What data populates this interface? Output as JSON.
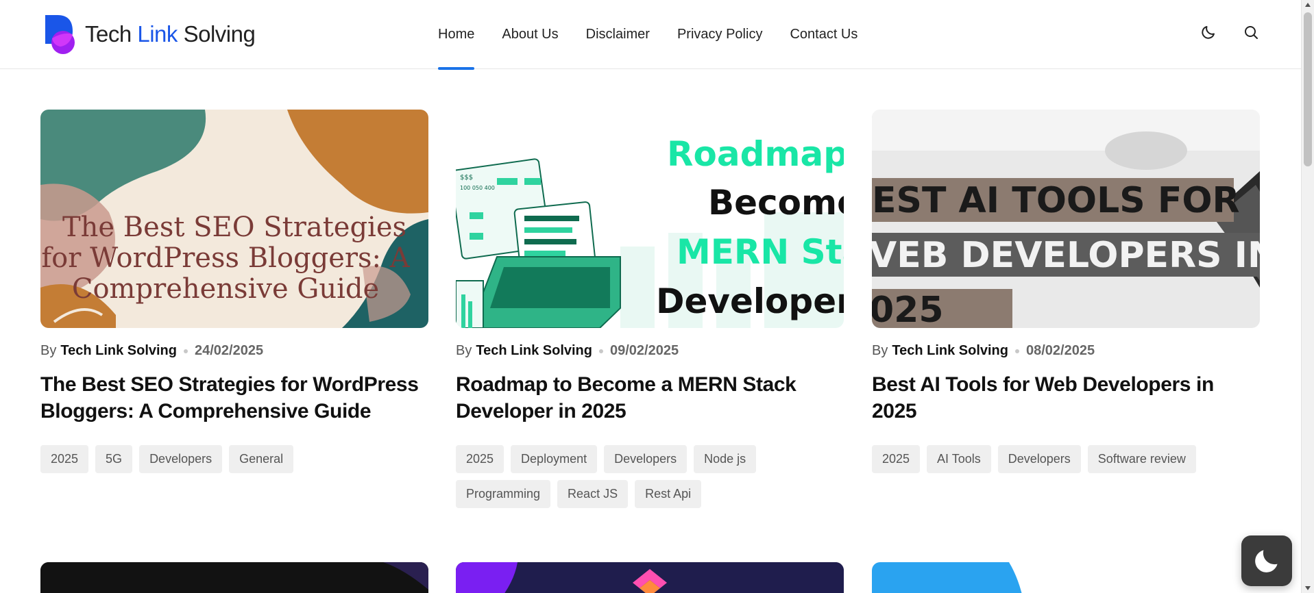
{
  "site": {
    "logo_word1": "Tech ",
    "logo_word2": "Link",
    "logo_word3": " Solving",
    "accent_color": "#1a56e8"
  },
  "nav": {
    "items": [
      {
        "label": "Home",
        "active": true
      },
      {
        "label": "About Us"
      },
      {
        "label": "Disclaimer"
      },
      {
        "label": "Privacy Policy"
      },
      {
        "label": "Contact Us"
      }
    ]
  },
  "header_icons": [
    "moon-icon",
    "search-icon"
  ],
  "posts": [
    {
      "by": "By",
      "author": "Tech Link Solving",
      "date": "24/02/2025",
      "title": "The Best SEO Strategies for WordPress Bloggers: A Comprehensive Guide",
      "image_text": [
        "The Best SEO Strategies",
        "for WordPress Bloggers: A",
        "Comprehensive Guide"
      ],
      "tags": [
        "2025",
        "5G",
        "Developers",
        "General"
      ]
    },
    {
      "by": "By",
      "author": "Tech Link Solving",
      "date": "09/02/2025",
      "title": "Roadmap to Become a MERN Stack Developer in 2025",
      "image_text": [
        "Roadmap t",
        "Become",
        "MERN Sta",
        "Developer"
      ],
      "image_small_text": [
        "$$$",
        "100 050 400"
      ],
      "tags": [
        "2025",
        "Deployment",
        "Developers",
        "Node js",
        "Programming",
        "React JS",
        "Rest Api"
      ]
    },
    {
      "by": "By",
      "author": "Tech Link Solving",
      "date": "08/02/2025",
      "title": "Best AI Tools for Web Developers in 2025",
      "image_text": [
        "EST AI TOOLS FOR",
        "VEB DEVELOPERS IN",
        "025"
      ],
      "tags": [
        "2025",
        "AI Tools",
        "Developers",
        "Software review"
      ]
    }
  ],
  "floating_button": "moon-icon"
}
